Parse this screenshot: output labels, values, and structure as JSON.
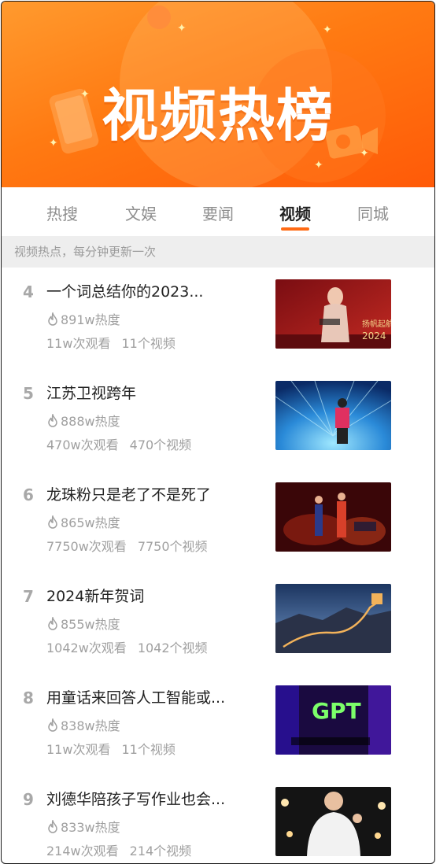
{
  "banner": {
    "title": "视频热榜"
  },
  "tabs": [
    {
      "label": "热搜",
      "active": false
    },
    {
      "label": "文娱",
      "active": false
    },
    {
      "label": "要闻",
      "active": false
    },
    {
      "label": "视频",
      "active": true
    },
    {
      "label": "同城",
      "active": false
    }
  ],
  "notice": "视频热点，每分钟更新一次",
  "items": [
    {
      "rank": "4",
      "title": "一个词总结你的2023...",
      "heat": "891w热度",
      "views": "11w次观看",
      "videos": "11个视频"
    },
    {
      "rank": "5",
      "title": "江苏卫视跨年",
      "heat": "888w热度",
      "views": "470w次观看",
      "videos": "470个视频"
    },
    {
      "rank": "6",
      "title": "龙珠粉只是老了不是死了",
      "heat": "865w热度",
      "views": "7750w次观看",
      "videos": "7750个视频"
    },
    {
      "rank": "7",
      "title": "2024新年贺词",
      "heat": "855w热度",
      "views": "1042w次观看",
      "videos": "1042个视频"
    },
    {
      "rank": "8",
      "title": "用童话来回答人工智能或...",
      "heat": "838w热度",
      "views": "11w次观看",
      "videos": "11个视频"
    },
    {
      "rank": "9",
      "title": "刘德华陪孩子写作业也会...",
      "heat": "833w热度",
      "views": "214w次观看",
      "videos": "214个视频"
    }
  ],
  "thumb_text": {
    "item4_caption": "扬帆起航",
    "item4_year": "2024",
    "item8_logo": "GPT"
  },
  "colors": {
    "accent": "#ff6a14",
    "banner": "#ff7a12",
    "muted": "#a0a0a0"
  }
}
